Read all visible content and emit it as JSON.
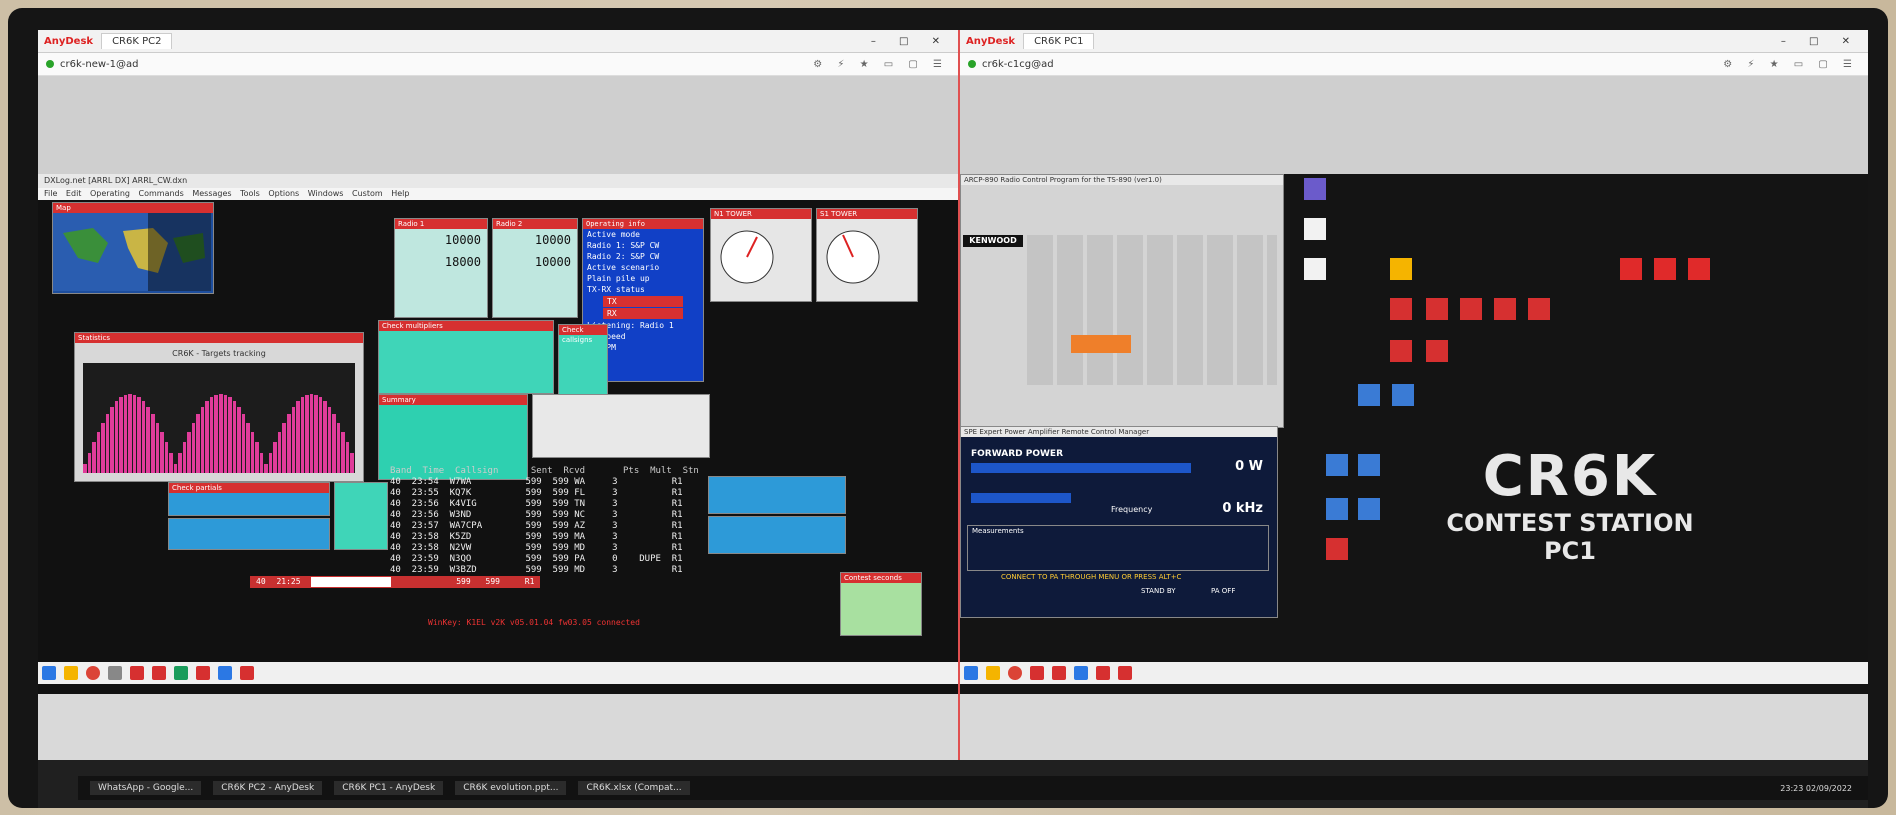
{
  "anydesk_left": {
    "brand": "AnyDesk",
    "tab": "CR6K PC2",
    "address": "cr6k-new-1@ad"
  },
  "anydesk_right": {
    "brand": "AnyDesk",
    "tab": "CR6K PC1",
    "address": "cr6k-c1cg@ad"
  },
  "n1mm": {
    "title": "DXLog.net [ARRL DX] ARRL_CW.dxn",
    "menu": "File  Edit  Operating  Commands  Messages  Tools  Options  Windows  Custom  Help",
    "map_title": "Map",
    "radio1_title": "Radio 1",
    "radio1_freq1": "10000",
    "radio1_freq2": "18000",
    "radio2_title": "Radio 2",
    "radio2_freq1": "10000",
    "radio2_freq2": "10000",
    "opinfo_title": "Operating info",
    "opinfo_lines": [
      "Active mode",
      "Radio 1:   S&P   CW",
      "Radio 2:   S&P   CW",
      "Active scenario",
      "Plain pile up",
      "TX-RX status",
      "TX",
      "RX",
      "Listening:   Radio 1",
      "CW speed",
      "42 WPM"
    ],
    "tower1_title": "N1 TOWER",
    "tower2_title": "S1 TOWER",
    "stats_title": "Statistics",
    "stats_plot_title": "CR6K - Targets tracking",
    "summary_title": "Summary",
    "check_mult_title": "Check multipliers",
    "check_callsign_title": "Check callsigns",
    "bandmap_title": "Check partials",
    "log_header": "Band  Time  Callsign      Sent  Rcvd       Pts  Mult  Stn",
    "log_rows": [
      "40  23:54  W7WA          599  599 WA     3          R1",
      "40  23:55  KQ7K          599  599 FL     3          R1",
      "40  23:56  K4VIG         599  599 TN     3          R1",
      "40  23:56  W3ND          599  599 NC     3          R1",
      "40  23:57  WA7CPA        599  599 AZ     3          R1",
      "40  23:58  K5ZD          599  599 MA     3          R1",
      "40  23:58  N2VW          599  599 MD     3          R1",
      "40  23:59  N3QO          599  599 PA     0    DUPE  R1",
      "40  23:59  W3BZD         599  599 MD     3          R1"
    ],
    "entry_band": "40",
    "entry_time": "21:25",
    "entry_sent": "599",
    "entry_rcvd": "599",
    "entry_stn": "R1",
    "status": "WinKey: K1EL v2K v05.01.04 fw03.05 connected",
    "contest_status_title": "Contest seconds"
  },
  "arcp": {
    "title": "ARCP-890 Radio Control Program for the TS-890 (ver1.0)",
    "brand": "KENWOOD"
  },
  "pa": {
    "title": "SPE Expert Power Amplifier Remote Control Manager",
    "forward_power": "FORWARD POWER",
    "power_value": "0 W",
    "freq_label": "Frequency",
    "freq_value": "0 kHz",
    "measurements": "Measurements",
    "connect_msg": "CONNECT TO PA THROUGH MENU OR PRESS ALT+C",
    "standby": "STAND BY",
    "pa_off": "PA OFF"
  },
  "desktop": {
    "logo_main": "CR6K",
    "logo_sub1": "CONTEST STATION",
    "logo_sub2": "PC1"
  },
  "host_taskbar": {
    "items": [
      "WhatsApp - Google...",
      "CR6K PC2 - AnyDesk",
      "CR6K PC1 - AnyDesk",
      "CR6K evolution.ppt...",
      "CR6K.xlsx (Compat..."
    ],
    "time": "23:23",
    "date": "02/09/2022"
  },
  "colors": {
    "accent_red": "#d63030",
    "n1mm_blue": "#1140c6",
    "teal": "#2ed0b0",
    "bar_pink": "#e03c9a",
    "pa_navy": "#0e1a3a"
  }
}
